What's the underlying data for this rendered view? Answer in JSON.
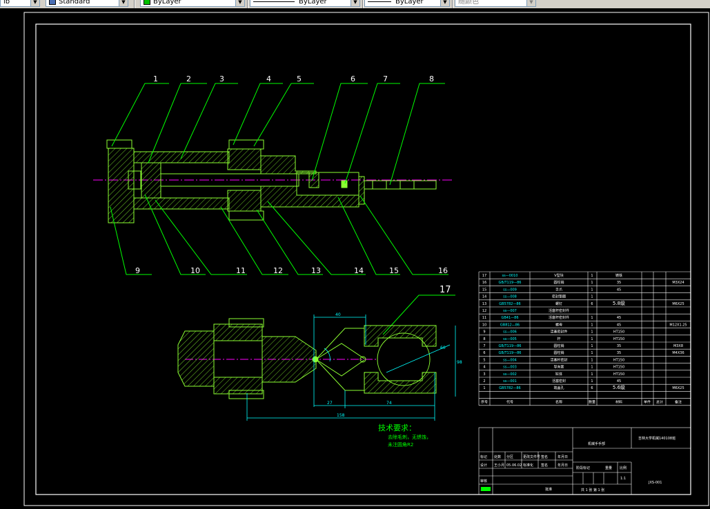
{
  "toolbar": {
    "workspace": "ib",
    "textstyle": "Standard",
    "color": "ByLayer",
    "color_swatch": "#00c000",
    "linetype": "ByLayer",
    "lineweight": "ByLayer",
    "plotstyle": "随颜色"
  },
  "colors": {
    "line": "#8cff32",
    "label": "#ffffff",
    "center": "#ff00ff",
    "dim": "#00ffff",
    "note": "#00ff00"
  },
  "callouts": [
    "1",
    "2",
    "3",
    "4",
    "5",
    "6",
    "7",
    "8",
    "9",
    "10",
    "11",
    "12",
    "13",
    "14",
    "15",
    "16",
    "17"
  ],
  "notes": {
    "title": "技术要求：",
    "lines": [
      "去除毛刺，无锈蚀，",
      "未注圆角R2"
    ]
  },
  "dims": {
    "d1": "40",
    "d2": "98",
    "d3": "27",
    "d4": "74",
    "d5": "158",
    "d6": "60"
  },
  "bom": {
    "rows": [
      {
        "no": "17",
        "code": "ss—0010",
        "name": "V型块",
        "qty": "1",
        "material": "铸铁",
        "note": ""
      },
      {
        "no": "16",
        "code": "GB/T119—86",
        "name": "圆柱销",
        "qty": "1",
        "material": "35",
        "note": "M3X24"
      },
      {
        "no": "15",
        "code": "ss—009",
        "name": "手爪",
        "qty": "1",
        "material": "45",
        "note": ""
      },
      {
        "no": "14",
        "code": "ss—008",
        "name": "密封垫圈",
        "qty": "1",
        "material": "",
        "note": ""
      },
      {
        "no": "13",
        "code": "GB5782—86",
        "name": "螺钉",
        "qty": "6",
        "material": "5.8级",
        "note": "M6X25"
      },
      {
        "no": "12",
        "code": "ss—007",
        "name": "活塞杆密封件",
        "qty": "",
        "material": "",
        "note": ""
      },
      {
        "no": "11",
        "code": "GB41—86",
        "name": "活塞杆密封件",
        "qty": "1",
        "material": "45",
        "note": ""
      },
      {
        "no": "10",
        "code": "GB812—86",
        "name": "螺母",
        "qty": "1",
        "material": "45",
        "note": "M12X1.25"
      },
      {
        "no": "9",
        "code": "ss—006",
        "name": "活塞密封件",
        "qty": "1",
        "material": "HT150",
        "note": ""
      },
      {
        "no": "8",
        "code": "ss—005",
        "name": "杆",
        "qty": "1",
        "material": "HT150",
        "note": ""
      },
      {
        "no": "7",
        "code": "GB/T119—86",
        "name": "圆柱销",
        "qty": "1",
        "material": "35",
        "note": "M3X8"
      },
      {
        "no": "6",
        "code": "GB/T119—86",
        "name": "圆柱销",
        "qty": "1",
        "material": "35",
        "note": "M4X36"
      },
      {
        "no": "5",
        "code": "ss—004",
        "name": "活塞杆密封",
        "qty": "1",
        "material": "HT150",
        "note": ""
      },
      {
        "no": "4",
        "code": "ss—003",
        "name": "导向套",
        "qty": "1",
        "material": "HT150",
        "note": ""
      },
      {
        "no": "3",
        "code": "ss—002",
        "name": "缸体",
        "qty": "1",
        "material": "HT150",
        "note": ""
      },
      {
        "no": "2",
        "code": "ss—001",
        "name": "活塞密封",
        "qty": "1",
        "material": "45",
        "note": ""
      },
      {
        "no": "1",
        "code": "GB5782—86",
        "name": "端盖孔",
        "qty": "6",
        "material": "5.6级",
        "note": "M6X25"
      }
    ],
    "header": {
      "no": "序号",
      "code": "代号",
      "name": "名称",
      "qty": "数量",
      "material": "材料",
      "unit_wt": "单件",
      "total_wt": "总计",
      "note": "备注"
    }
  },
  "titleblock": {
    "drawing_name": "机械手手部",
    "school": "吉林大学机械140108班",
    "labels": [
      "标记",
      "处数",
      "分区",
      "更改文件号",
      "签名",
      "年月日",
      "设计",
      "王小月",
      "05.06.02",
      "标准化",
      "签名",
      "年月日",
      "审核",
      "工艺",
      "批准"
    ],
    "stage": "阶段标记",
    "weight": "重量",
    "scale": "比例",
    "scale_val": "1:1",
    "sheet": "共 1 张  第 1 张",
    "code": "JXS-001"
  }
}
